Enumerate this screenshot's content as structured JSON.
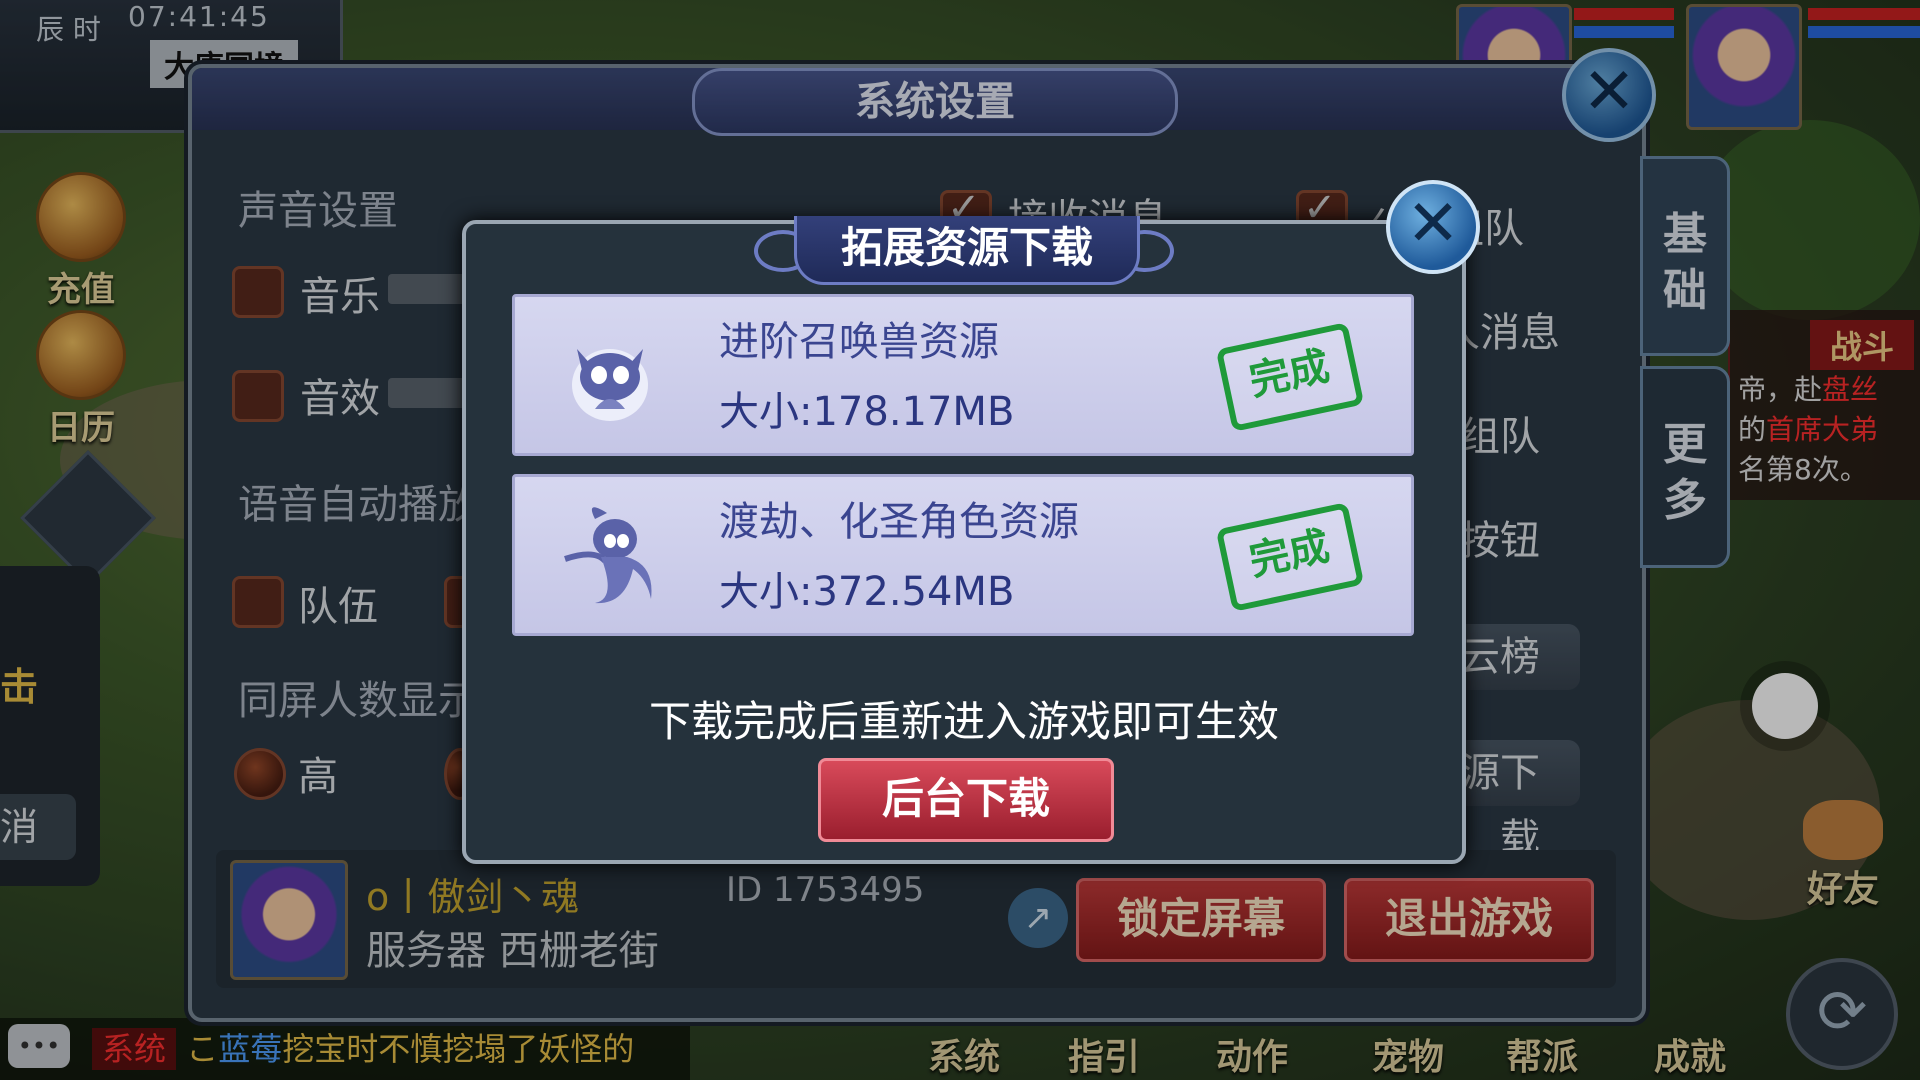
{
  "hud": {
    "clock": "07:41:45",
    "season": "辰 时",
    "place": "大唐国境"
  },
  "left_icons": [
    {
      "label": "充值",
      "icon": "recharge-icon"
    },
    {
      "label": "日历",
      "icon": "calendar-icon"
    }
  ],
  "left_partials": {
    "attack": "击",
    "cancel": "消"
  },
  "combat": {
    "title": "战斗",
    "line1_pre": "帝，赴",
    "line1_red": "盘丝",
    "line2_pre": "的",
    "line2_red": "首席大弟",
    "line3": "名第8次。"
  },
  "bottom_menu": [
    "系统",
    "指引",
    "动作",
    "宠物",
    "帮派",
    "成就"
  ],
  "friend_label": "好友",
  "chat": {
    "tag": "系统",
    "message_pre": "こ",
    "message_blue": "蓝莓",
    "message_post": "挖宝时不慎挖塌了妖怪的"
  },
  "settings": {
    "title": "系统设置",
    "sound_section": "声音设置",
    "music": "音乐",
    "effects": "音效",
    "voice_section": "语音自动播放",
    "team": "队伍",
    "same_screen_section": "同屏人数显示",
    "high": "高",
    "right_options": {
      "receive_msg": "接收消息",
      "allow_team": "允许组队",
      "stranger_msg": "陌生人消息",
      "invite_team": "邀请组队",
      "assist_btn": "辅助按钮",
      "cloud_rank": "风云榜",
      "download": "资源下载"
    },
    "tabs": {
      "basic": "基础",
      "more": "更多"
    },
    "player": {
      "name": "o丨傲剑丶魂",
      "id": "ID 1753495",
      "server": "服务器 西栅老街"
    },
    "lock_screen": "锁定屏幕",
    "exit_game": "退出游戏"
  },
  "download_dialog": {
    "title": "拓展资源下载",
    "items": [
      {
        "name": "进阶召唤兽资源",
        "size": "大小:178.17MB",
        "status": "完成",
        "icon": "raccoon-icon"
      },
      {
        "name": "渡劫、化圣角色资源",
        "size": "大小:372.54MB",
        "status": "完成",
        "icon": "character-icon"
      }
    ],
    "hint": "下载完成后重新进入游戏即可生效",
    "button": "后台下载"
  }
}
